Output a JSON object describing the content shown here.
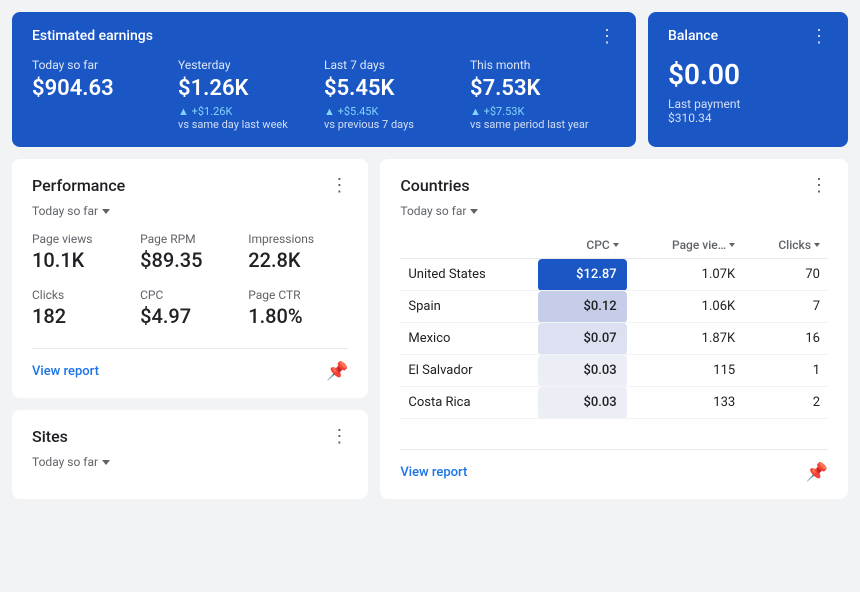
{
  "earnings": {
    "card_title": "Estimated earnings",
    "items": [
      {
        "label": "Today so far",
        "value": "$904.63",
        "sub": "",
        "change": ""
      },
      {
        "label": "Yesterday",
        "value": "$1.26K",
        "change": "▲ +$1.26K",
        "sub": "vs same day last week"
      },
      {
        "label": "Last 7 days",
        "value": "$5.45K",
        "change": "▲ +$5.45K",
        "sub": "vs previous 7 days"
      },
      {
        "label": "This month",
        "value": "$7.53K",
        "change": "▲ +$7.53K",
        "sub": "vs same period last year"
      }
    ]
  },
  "balance": {
    "card_title": "Balance",
    "value": "$0.00",
    "sub_label": "Last payment",
    "sub_value": "$310.34"
  },
  "performance": {
    "section_title": "Performance",
    "period": "Today so far",
    "metrics": [
      {
        "label": "Page views",
        "value": "10.1K"
      },
      {
        "label": "Page RPM",
        "value": "$89.35"
      },
      {
        "label": "Impressions",
        "value": "22.8K"
      },
      {
        "label": "Clicks",
        "value": "182"
      },
      {
        "label": "CPC",
        "value": "$4.97"
      },
      {
        "label": "Page CTR",
        "value": "1.80%"
      }
    ],
    "view_report": "View report"
  },
  "countries": {
    "section_title": "Countries",
    "period": "Today so far",
    "columns": [
      {
        "label": "CPC",
        "sortable": true
      },
      {
        "label": "Page vie…",
        "sortable": true
      },
      {
        "label": "Clicks",
        "sortable": true
      }
    ],
    "rows": [
      {
        "country": "United States",
        "cpc": "$12.87",
        "page_views": "1.07K",
        "clicks": "70",
        "cpc_class": "cpc-blue-dark"
      },
      {
        "country": "Spain",
        "cpc": "$0.12",
        "page_views": "1.06K",
        "clicks": "7",
        "cpc_class": "cpc-blue-light1"
      },
      {
        "country": "Mexico",
        "cpc": "$0.07",
        "page_views": "1.87K",
        "clicks": "16",
        "cpc_class": "cpc-blue-light2"
      },
      {
        "country": "El Salvador",
        "cpc": "$0.03",
        "page_views": "115",
        "clicks": "1",
        "cpc_class": "cpc-blue-light3"
      },
      {
        "country": "Costa Rica",
        "cpc": "$0.03",
        "page_views": "133",
        "clicks": "2",
        "cpc_class": "cpc-blue-light4"
      }
    ],
    "view_report": "View report"
  },
  "sites": {
    "section_title": "Sites",
    "period": "Today so far"
  },
  "icons": {
    "dots": "⋮",
    "pin": "📌",
    "arrow_up": "▲"
  }
}
